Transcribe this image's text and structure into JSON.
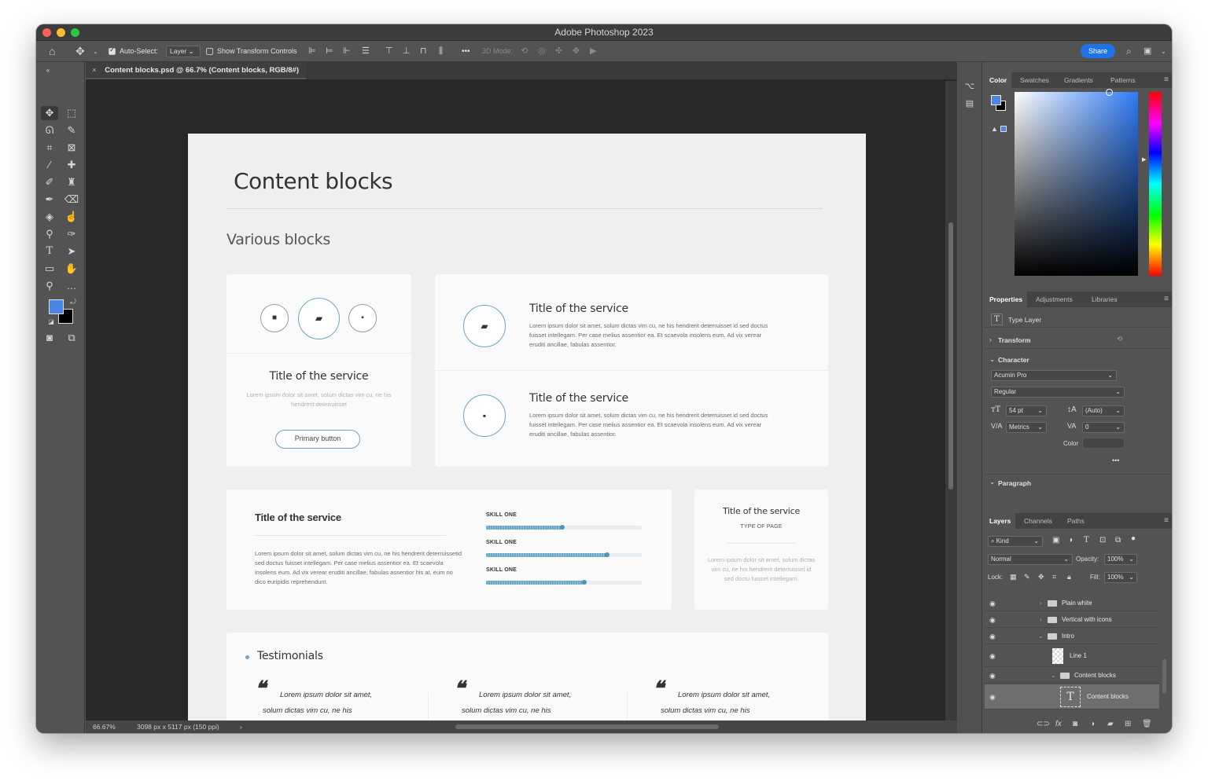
{
  "window": {
    "title": "Adobe Photoshop 2023",
    "colors": {
      "close": "#ff5f57",
      "minimize": "#febc2e",
      "zoom": "#28c840"
    }
  },
  "options_bar": {
    "auto_select_label": "Auto-Select:",
    "auto_select_value": "Layer",
    "show_transform_label": "Show Transform Controls",
    "mode_3d_label": "3D Mode:",
    "more_label": "•••",
    "share_label": "Share",
    "icons": [
      "home-icon",
      "move-tool-icon",
      "align-icon",
      "distribute-icon",
      "search-icon",
      "workspace-icon"
    ]
  },
  "document": {
    "tab_label": "Content blocks.psd @ 66.7% (Content blocks, RGB/8#)",
    "close_glyph": "×"
  },
  "status": {
    "zoom": "66.67%",
    "size": "3098 px x 5117 px (150 ppi)",
    "arrow": "›"
  },
  "canvas": {
    "page_title": "Content blocks",
    "section_title": "Various blocks",
    "card1": {
      "title": "Title of the service",
      "body": "Lorem ipsum dolor sit amet, solum dictas vim cu, ne his hendrerit deterruisset",
      "button": "Primary button"
    },
    "card2": {
      "items": [
        {
          "title": "Title of the service",
          "body": "Lorem ipsum dolor sit amet, solum dictas vim cu, ne his hendrerit deterruisset id sed doctus fuisset intellegam. Per case melius assentior ea. Et scaevola insolens eum. Ad vix verear eruditi ancillae, fabulas assentior."
        },
        {
          "title": "Title of the service",
          "body": "Lorem ipsum dolor sit amet, solum dictas vim cu, ne his hendrerit deterruisset id sed doctus fuisset intellegam. Per case melius assentior ea. Et scaevola insolens eum. Ad vix verear eruditi ancillae, fabulas assentior."
        }
      ]
    },
    "card3": {
      "title": "Title of the service",
      "body": "Lorem ipsum dolor sit amet, solum dictas vim cu, ne his hendrerit deterruissetid sed doctus fuisset intellegam. Per case melius assentior ea. Et scaevola insolens eum. Ad vix verear eruditi ancillae, fabulas assentior his at, eum no dico euripidis reprehendunt.",
      "skills": [
        {
          "label": "SKILL ONE",
          "level": 0.49
        },
        {
          "label": "SKILL ONE",
          "level": 0.78
        },
        {
          "label": "SKILL ONE",
          "level": 0.63
        }
      ]
    },
    "card4": {
      "title": "Title of the service",
      "subtitle": "TYPE OF PAGE",
      "body": "Lorem ipsum dolor sit amet, solum dictas vim cu, ne his hendrerit deterruisset id sed doctu fuisset intellegam."
    },
    "testimonials": {
      "title": "Testimonials",
      "quote_mark": "❝",
      "quotes": [
        {
          "line1": "Lorem ipsum dolor sit amet,",
          "line2": "solum dictas vim cu, ne his"
        },
        {
          "line1": "Lorem ipsum dolor sit amet,",
          "line2": "solum dictas vim cu, ne his"
        },
        {
          "line1": "Lorem ipsum dolor sit amet,",
          "line2": "solum dictas vim cu, ne his"
        }
      ]
    },
    "accent_color": "#6ba3c3"
  },
  "panels": {
    "color_tabs": [
      "Color",
      "Swatches",
      "Gradients",
      "Patterns"
    ],
    "properties_tabs": [
      "Properties",
      "Adjustments",
      "Libraries"
    ],
    "properties": {
      "layer_type": "Type Layer",
      "transform_label": "Transform",
      "character_label": "Character",
      "font_family": "Acumin Pro",
      "font_style": "Regular",
      "font_size": "54 pt",
      "leading": "(Auto)",
      "kerning": "Metrics",
      "tracking": "0",
      "color_label": "Color",
      "paragraph_label": "Paragraph",
      "more": "•••"
    },
    "layers_tabs": [
      "Layers",
      "Channels",
      "Paths"
    ],
    "layers": {
      "filter_kind": "Kind",
      "blend_mode": "Normal",
      "opacity_label": "Opacity:",
      "opacity": "100%",
      "lock_label": "Lock:",
      "fill_label": "Fill:",
      "fill": "100%",
      "items": [
        {
          "name": "Plain white",
          "type": "folder",
          "expanded": false
        },
        {
          "name": "Vertical with icons",
          "type": "folder",
          "expanded": false
        },
        {
          "name": "Intro",
          "type": "folder",
          "expanded": true
        },
        {
          "name": "Line 1",
          "type": "pixel"
        },
        {
          "name": "Content blocks",
          "type": "folder",
          "expanded": true
        },
        {
          "name": "Content blocks",
          "type": "text",
          "selected": true
        }
      ]
    },
    "foreground_color": "#4a86e8",
    "background_color": "#000000"
  }
}
